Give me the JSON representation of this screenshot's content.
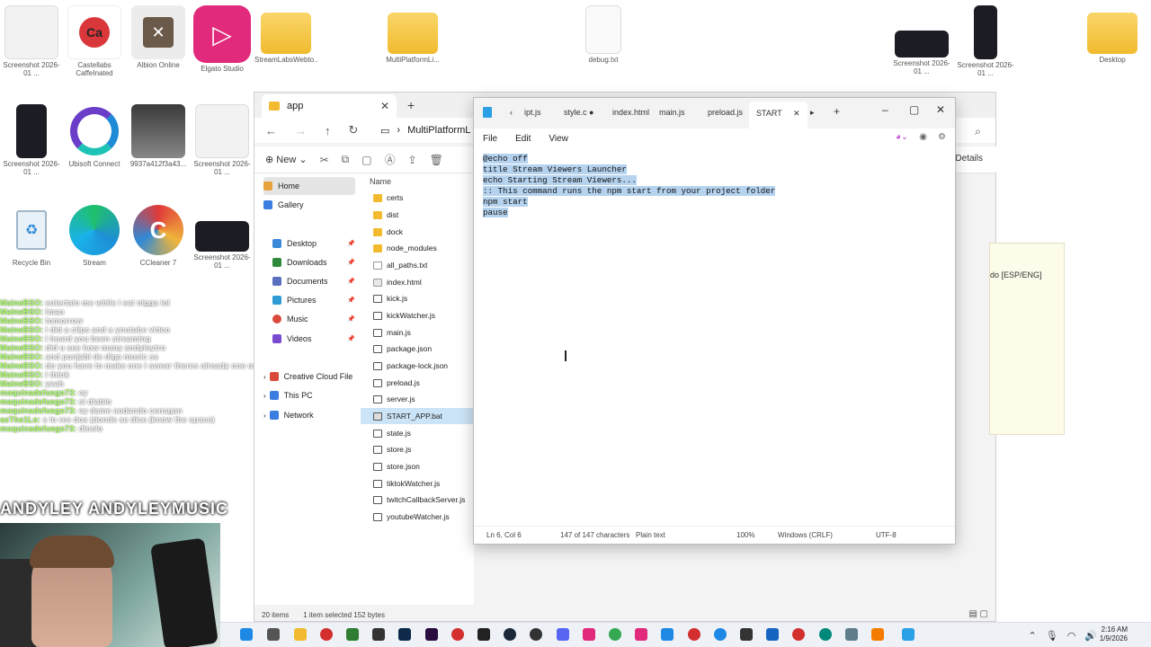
{
  "desktop": {
    "icons": [
      {
        "label": "Screenshot 2026-01 ..."
      },
      {
        "label": "Castellabs CaffeInated"
      },
      {
        "label": "Albion Online"
      },
      {
        "label": "Elgato Studio"
      },
      {
        "label": "StreamLabsWebto..."
      },
      {
        "label": "MultiPlatformLi..."
      },
      {
        "label": "debug.txt"
      },
      {
        "label": "Screenshot 2026-01 ..."
      },
      {
        "label": "Screenshot 2026-01 ..."
      },
      {
        "label": "Desktop"
      },
      {
        "label": "Screenshot 2026-01 ..."
      },
      {
        "label": "Ubisoft Connect"
      },
      {
        "label": "9937a412f3a43..."
      },
      {
        "label": "Screenshot 2026-01 ..."
      },
      {
        "label": "Recycle Bin"
      },
      {
        "label": "Stream"
      },
      {
        "label": "CCleaner 7"
      },
      {
        "label": "Screenshot 2026-01 ..."
      }
    ]
  },
  "overlay": {
    "chat": [
      {
        "name": "MaineBSO:",
        "text": "entertain me while i eat nigga lol"
      },
      {
        "name": "MaineBSO:",
        "text": "lmao"
      },
      {
        "name": "MaineBSO:",
        "text": "tomorrow"
      },
      {
        "name": "MaineBSO:",
        "text": "i did a clips and a youtube video"
      },
      {
        "name": "MaineBSO:",
        "text": "i heard you been streaming"
      },
      {
        "name": "MaineBSO:",
        "text": "did u see how many andyleytro"
      },
      {
        "name": "MaineBSO:",
        "text": "and punjabi de diga music ss"
      },
      {
        "name": "MaineBSO:",
        "text": "do you have to make one i swear theres already one out there"
      },
      {
        "name": "MaineBSO:",
        "text": "i think"
      },
      {
        "name": "MaineBSO:",
        "text": "yeah"
      },
      {
        "name": "maquinadefuego73:",
        "text": "ey"
      },
      {
        "name": "maquinadefuego73:",
        "text": "el diablo"
      },
      {
        "name": "maquinadefuego73:",
        "text": "ey dame andando cenagan"
      },
      {
        "name": "asThe1Lo:",
        "text": "s lo res dos (donde se dice (know the space)"
      },
      {
        "name": "maquinadefuego73:",
        "text": "dinelo"
      }
    ],
    "banner": "ANDYLEY   ANDYLEYMUSIC"
  },
  "explorer": {
    "tab_title": "app",
    "address": "MultiPlatformL",
    "toolbar_new": "New",
    "details_label": "Details",
    "column_name": "Name",
    "nav": [
      {
        "label": "Home",
        "selected": true,
        "color": "#e6a23c"
      },
      {
        "label": "Gallery",
        "selected": false,
        "color": "#3b7de0"
      },
      {
        "label": "Desktop",
        "selected": false,
        "color": "#3b8ad9"
      },
      {
        "label": "Downloads",
        "selected": false,
        "color": "#2f8a3b"
      },
      {
        "label": "Documents",
        "selected": false,
        "color": "#5b6fbf"
      },
      {
        "label": "Pictures",
        "selected": false,
        "color": "#2f9bd6"
      },
      {
        "label": "Music",
        "selected": false,
        "color": "#d94a3a"
      },
      {
        "label": "Videos",
        "selected": false,
        "color": "#7a4bd1"
      },
      {
        "label": "Creative Cloud File",
        "selected": false,
        "color": "#d94a3a"
      },
      {
        "label": "This PC",
        "selected": false,
        "color": "#3b7de0"
      },
      {
        "label": "Network",
        "selected": false,
        "color": "#3b7de0"
      }
    ],
    "files": [
      {
        "name": "certs",
        "type": "folder"
      },
      {
        "name": "dist",
        "type": "folder"
      },
      {
        "name": "dock",
        "type": "folder"
      },
      {
        "name": "node_modules",
        "type": "folder"
      },
      {
        "name": "all_paths.txt",
        "type": "txt"
      },
      {
        "name": "index.html",
        "type": "html"
      },
      {
        "name": "kick.js",
        "type": "js"
      },
      {
        "name": "kickWatcher.js",
        "type": "js"
      },
      {
        "name": "main.js",
        "type": "js"
      },
      {
        "name": "package.json",
        "type": "json"
      },
      {
        "name": "package-lock.json",
        "type": "json"
      },
      {
        "name": "preload.js",
        "type": "js"
      },
      {
        "name": "server.js",
        "type": "js"
      },
      {
        "name": "START_APP.bat",
        "type": "bat",
        "selected": true
      },
      {
        "name": "state.js",
        "type": "js"
      },
      {
        "name": "store.js",
        "type": "js"
      },
      {
        "name": "store.json",
        "type": "json"
      },
      {
        "name": "tiktokWatcher.js",
        "type": "js"
      },
      {
        "name": "twitchCallbackServer.js",
        "type": "js"
      },
      {
        "name": "youtubeWatcher.js",
        "type": "js"
      }
    ],
    "status_items": "20 items",
    "status_selected": "1 item selected  152 bytes"
  },
  "notepad_bg_text": "do [ESP/ENG]",
  "notepad": {
    "tabs": [
      "ipt.js",
      "style.c",
      "index.html",
      "main.js",
      "preload.js",
      "START"
    ],
    "menu": {
      "file": "File",
      "edit": "Edit",
      "view": "View"
    },
    "lines": [
      "@echo off",
      "title Stream Viewers Launcher",
      "echo Starting Stream Viewers...",
      ":: This command runs the npm start from your project folder",
      "npm start",
      "pause"
    ],
    "status": {
      "position": "Ln 6, Col 6",
      "chars": "147 of 147 characters",
      "format": "Plain text",
      "zoom": "100%",
      "eol": "Windows (CRLF)",
      "encoding": "UTF-8"
    }
  },
  "taskbar": {
    "time": "2:16 AM",
    "date": "1/9/2026"
  }
}
